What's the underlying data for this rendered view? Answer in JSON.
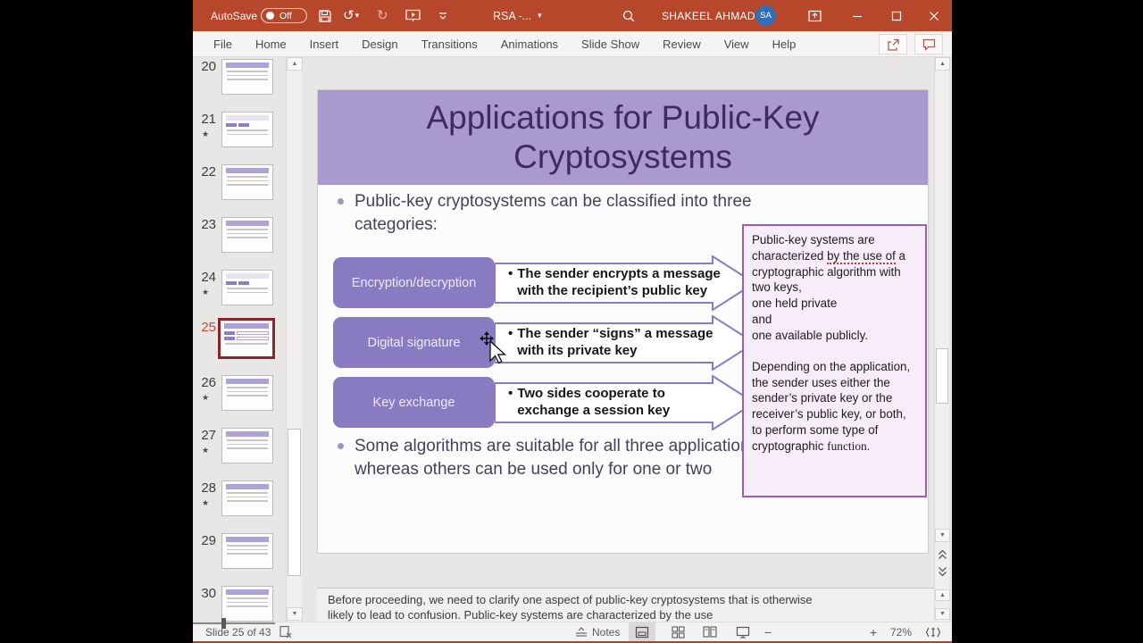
{
  "titlebar": {
    "autosave_label": "AutoSave",
    "autosave_state": "Off",
    "doc_title": "RSA -...",
    "user_name": "SHAKEEL AHMAD",
    "user_initials": "SA"
  },
  "ribbon": {
    "tabs": [
      "File",
      "Home",
      "Insert",
      "Design",
      "Transitions",
      "Animations",
      "Slide Show",
      "Review",
      "View",
      "Help"
    ]
  },
  "icons": {
    "undo": "↺",
    "redo": "↻",
    "caret_down": "▾",
    "scroll_up": "▲",
    "scroll_down": "▼",
    "minus": "−",
    "plus": "+",
    "bullet": "•"
  },
  "sidebar": {
    "slides": [
      {
        "number": "20",
        "star": ""
      },
      {
        "number": "21",
        "star": "★"
      },
      {
        "number": "22",
        "star": ""
      },
      {
        "number": "23",
        "star": ""
      },
      {
        "number": "24",
        "star": "★"
      },
      {
        "number": "25",
        "star": ""
      },
      {
        "number": "26",
        "star": "★"
      },
      {
        "number": "27",
        "star": "★"
      },
      {
        "number": "28",
        "star": "★"
      },
      {
        "number": "29",
        "star": ""
      },
      {
        "number": "30",
        "star": ""
      }
    ]
  },
  "slide": {
    "title": "Applications for Public-Key Cryptosystems",
    "bullet1": "Public-key cryptosystems can be classified into three categories:",
    "categories": [
      {
        "label": "Encryption/decryption",
        "desc": "The sender encrypts a message with the recipient’s public key"
      },
      {
        "label": "Digital signature",
        "desc": "The sender “signs” a message with its private key"
      },
      {
        "label": "Key exchange",
        "desc": "Two sides cooperate to exchange a session key"
      }
    ],
    "bullet2": "Some algorithms are suitable for all three applications, whereas others can be used only for one or two",
    "sidebox": {
      "p1_before": "Public-key systems are characterized ",
      "p1_underline": "by the use of",
      "p1_after": " a cryptographic algorithm with two keys,",
      "p1_line2": "one held private",
      "p1_line3": "and",
      "p1_line4": "one available publicly.",
      "p2": "Depending on the application, the sender uses either the sender’s private key or the receiver’s public key, or both, to perform some type of cryptographic ",
      "p2_end": "function."
    }
  },
  "notes": {
    "text": "Before proceeding, we need to clarify one aspect of public-key cryptosystems that is otherwise likely to lead to confusion. Public-key systems are characterized by the use"
  },
  "statusbar": {
    "slide_indicator": "Slide 25 of 43",
    "notes_label": "Notes",
    "zoom_level": "72%"
  },
  "colors": {
    "titlebar": "#b7472a",
    "slide_title_band": "#a89ace",
    "category_box": "#897bc2",
    "sidebox_border": "#9c5ea9",
    "selected_thumb_border": "#8c2626",
    "avatar": "#2e6fb7"
  }
}
